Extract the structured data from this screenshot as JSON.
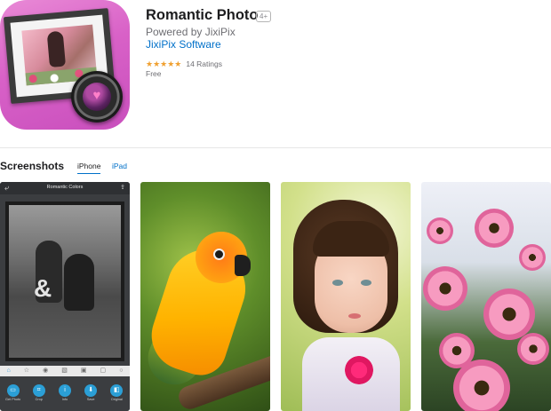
{
  "app": {
    "title": "Romantic Photo",
    "age_rating": "4+",
    "subtitle": "Powered by JixiPix",
    "developer": "JixiPix Software",
    "stars": "★★★★★",
    "ratings_count": "14 Ratings",
    "rating_value": 4.5,
    "price": "Free",
    "icon": "romantic-photo-app-icon"
  },
  "screenshots": {
    "section_title": "Screenshots",
    "tabs": [
      {
        "label": "iPhone",
        "selected": true
      },
      {
        "label": "iPad",
        "selected": false
      }
    ],
    "shot1": {
      "app_title": "Romantic Colors",
      "back_icon": "back-arrow-icon",
      "share_icon": "share-icon",
      "toolbar_icons": [
        "home-icon",
        "star-icon",
        "circle-icon",
        "layers-icon",
        "portrait-icon",
        "frame-icon",
        "circle-outline-icon"
      ],
      "bottom_buttons": [
        {
          "label": "Get Photo",
          "icon": "photo-icon"
        },
        {
          "label": "Crop",
          "icon": "crop-icon"
        },
        {
          "label": "Info",
          "icon": "info-icon"
        },
        {
          "label": "Save",
          "icon": "save-icon"
        },
        {
          "label": "Original",
          "icon": "original-icon"
        }
      ]
    }
  },
  "colors": {
    "accent_link": "#0070c9",
    "star": "#f0a030",
    "icon_pink": "#d861c7"
  }
}
